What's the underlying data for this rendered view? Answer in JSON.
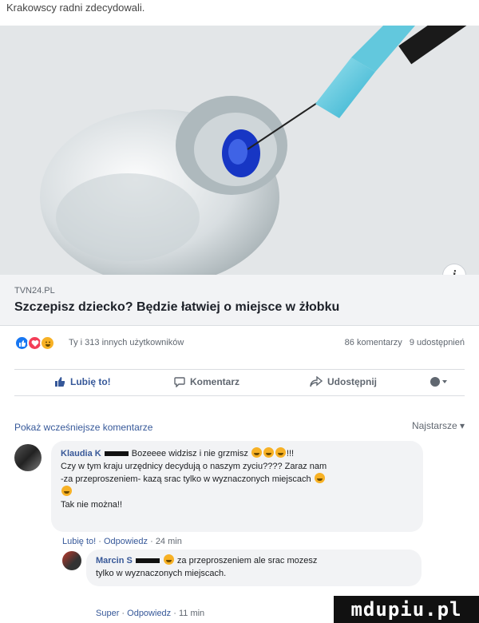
{
  "top_text": "Krakowscy radni zdecydowali.",
  "link_preview": {
    "domain": "TVN24.PL",
    "title": "Szczepisz dziecko? Będzie łatwiej o miejsce w żłobku",
    "info_icon": "info-icon"
  },
  "reactions": {
    "icons": [
      "like-icon",
      "love-icon",
      "haha-icon"
    ],
    "summary": "Ty i 313 innych użytkowników",
    "comments": "86 komentarzy",
    "shares": "9 udostępnień"
  },
  "actions": {
    "like": "Lubię to!",
    "comment": "Komentarz",
    "share": "Udostępnij"
  },
  "comments_header": {
    "previous": "Pokaż wcześniejsze komentarze",
    "sort": "Najstarsze ▾"
  },
  "comments": [
    {
      "author": "Klaudia K",
      "line1": "Bozeeee widzisz i nie grzmisz",
      "line1_end": "!!!",
      "line2": "Czy w tym kraju urzędnicy decydują o naszym zyciu???? Zaraz nam",
      "line3": "-za przeproszeniem- kazą srac tylko w wyznaczonych miejscach",
      "line5": "Tak nie można!!",
      "like": "Lubię to!",
      "reply": "Odpowiedz",
      "time": "24 min"
    },
    {
      "author": "Marcin S",
      "line1": "za przeproszeniem ale srac mozesz",
      "line2": "tylko w wyznaczonych miejscach.",
      "like": "Super",
      "reply": "Odpowiedz",
      "time": "11 min"
    }
  ],
  "watermark": "mdupiu.pl",
  "colors": {
    "link": "#365899",
    "like_blue": "#1877f2",
    "bubble": "#f2f3f5"
  }
}
